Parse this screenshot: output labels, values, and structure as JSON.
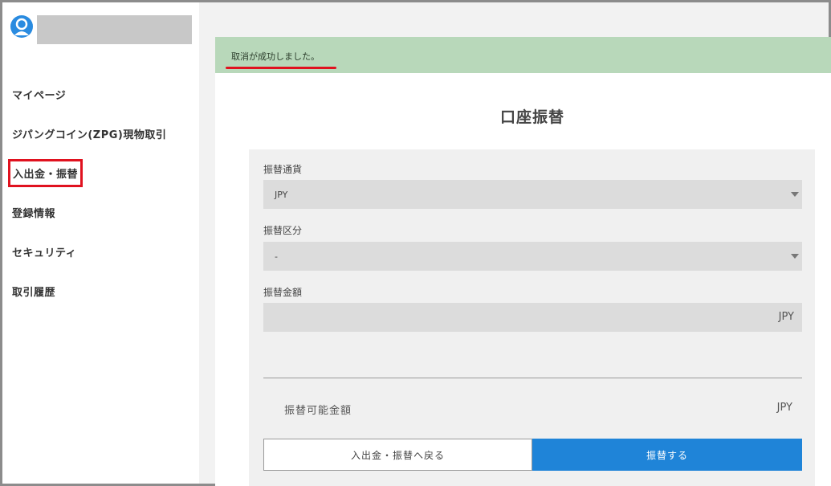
{
  "sidebar": {
    "items": [
      {
        "label": "マイページ"
      },
      {
        "label": "ジパングコイン(ZPG)現物取引"
      },
      {
        "label": "入出金・振替"
      },
      {
        "label": "登録情報"
      },
      {
        "label": "セキュリティ"
      },
      {
        "label": "取引履歴"
      }
    ]
  },
  "alert": {
    "message": "取消が成功しました。"
  },
  "page": {
    "title": "口座振替"
  },
  "form": {
    "currency_label": "振替通貨",
    "currency_value": "JPY",
    "category_label": "振替区分",
    "category_value": "-",
    "amount_label": "振替金額",
    "amount_unit": "JPY",
    "available_label": "振替可能金額",
    "available_unit": "JPY",
    "back_button": "入出金・振替へ戻る",
    "submit_button": "振替する"
  },
  "colors": {
    "accent": "#1f84d8",
    "highlight": "#e0121f",
    "alert_bg": "#b8d8ba"
  }
}
